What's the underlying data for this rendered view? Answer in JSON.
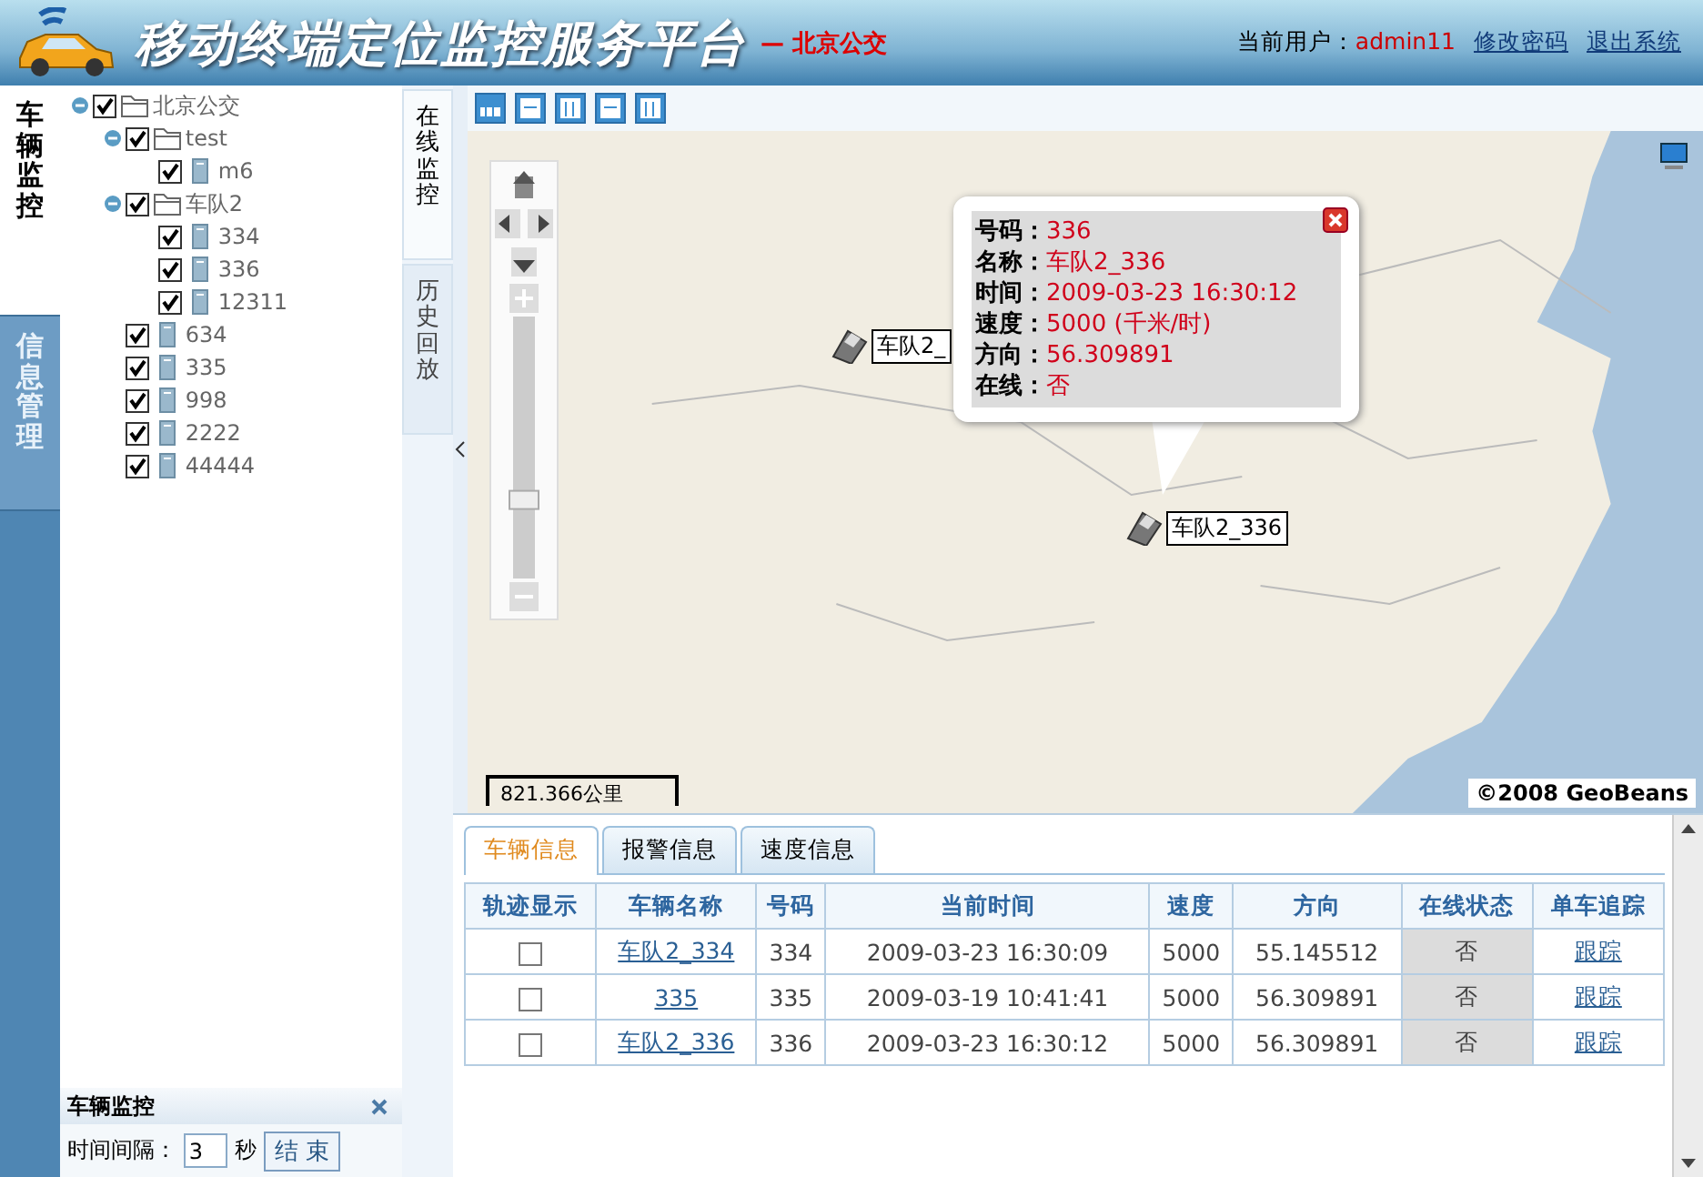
{
  "header": {
    "title": "移动终端定位监控服务平台",
    "subtitle": "— 北京公交",
    "user_label": "当前用户：",
    "user": "admin11",
    "links": [
      "修改密码",
      "退出系统"
    ]
  },
  "rail_tabs": [
    {
      "label": "车辆监控",
      "selected": true
    },
    {
      "label": "信息管理",
      "selected": false
    }
  ],
  "tree": [
    {
      "label": "北京公交",
      "kind": "folder",
      "checked": true,
      "expanded": true,
      "children": [
        {
          "label": "test",
          "kind": "folder",
          "checked": true,
          "expanded": true,
          "children": [
            {
              "label": "m6",
              "kind": "vehicle",
              "checked": true
            }
          ]
        },
        {
          "label": "车队2",
          "kind": "folder",
          "checked": true,
          "expanded": true,
          "children": [
            {
              "label": "334",
              "kind": "vehicle",
              "checked": true
            },
            {
              "label": "336",
              "kind": "vehicle",
              "checked": true
            },
            {
              "label": "12311",
              "kind": "vehicle",
              "checked": true
            }
          ]
        },
        {
          "label": "634",
          "kind": "vehicle",
          "checked": true
        },
        {
          "label": "335",
          "kind": "vehicle",
          "checked": true
        },
        {
          "label": "998",
          "kind": "vehicle",
          "checked": true
        },
        {
          "label": "2222",
          "kind": "vehicle",
          "checked": true
        },
        {
          "label": "44444",
          "kind": "vehicle",
          "checked": true
        }
      ]
    }
  ],
  "side_tabs": [
    {
      "label": "在线监控",
      "selected": true
    },
    {
      "label": "历史回放",
      "selected": false
    }
  ],
  "monitor_panel": {
    "title": "车辆监控",
    "interval_label": "时间间隔：",
    "interval_value": "3",
    "unit": "秒",
    "button": "结 束"
  },
  "map": {
    "zoom_slider": {
      "level": 0.3
    },
    "markers": [
      {
        "label": "车队2_"
      },
      {
        "label": "车队2_336"
      }
    ],
    "popup": {
      "fields": [
        {
          "label": "号码：",
          "value": "336"
        },
        {
          "label": "名称：",
          "value": "车队2_336"
        },
        {
          "label": "时间：",
          "value": "2009-03-23 16:30:12"
        },
        {
          "label": "速度：",
          "value": "5000 (千米/时)"
        },
        {
          "label": "方向：",
          "value": "56.309891"
        },
        {
          "label": "在线：",
          "value": "否"
        }
      ]
    },
    "scale": "821.366公里",
    "copyright": "©2008 GeoBeans"
  },
  "bottom_tabs": [
    {
      "label": "车辆信息",
      "selected": true
    },
    {
      "label": "报警信息",
      "selected": false
    },
    {
      "label": "速度信息",
      "selected": false
    }
  ],
  "table": {
    "columns": [
      "轨迹显示",
      "车辆名称",
      "号码",
      "当前时间",
      "速度",
      "方向",
      "在线状态",
      "单车追踪"
    ],
    "rows": [
      {
        "checked": false,
        "name": "车队2_334",
        "number": "334",
        "time": "2009-03-23 16:30:09",
        "speed": "5000",
        "direction": "55.145512",
        "online": "否",
        "action": "跟踪"
      },
      {
        "checked": false,
        "name": "335",
        "number": "335",
        "time": "2009-03-19 10:41:41",
        "speed": "5000",
        "direction": "56.309891",
        "online": "否",
        "action": "跟踪"
      },
      {
        "checked": false,
        "name": "车队2_336",
        "number": "336",
        "time": "2009-03-23 16:30:12",
        "speed": "5000",
        "direction": "56.309891",
        "online": "否",
        "action": "跟踪"
      }
    ]
  }
}
